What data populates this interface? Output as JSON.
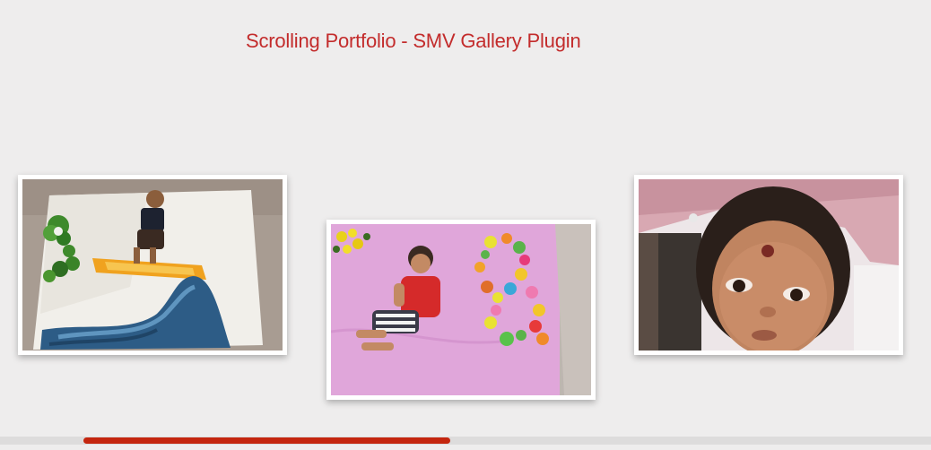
{
  "page": {
    "title": "Scrolling Portfolio - SMV Gallery Plugin"
  },
  "colors": {
    "background": "#eeeded",
    "title": "#c32c2c",
    "scrollbar_thumb": "#c4260f",
    "scrollbar_track": "#dddcdc"
  },
  "gallery": {
    "items": [
      {
        "icon": "photo-baby-on-white-sheet"
      },
      {
        "icon": "photo-baby-on-pink-sheet-with-toys"
      },
      {
        "icon": "photo-baby-face-closeup"
      }
    ]
  },
  "scrollbar": {
    "position_fraction": 0.0,
    "visible_fraction": 0.39
  }
}
